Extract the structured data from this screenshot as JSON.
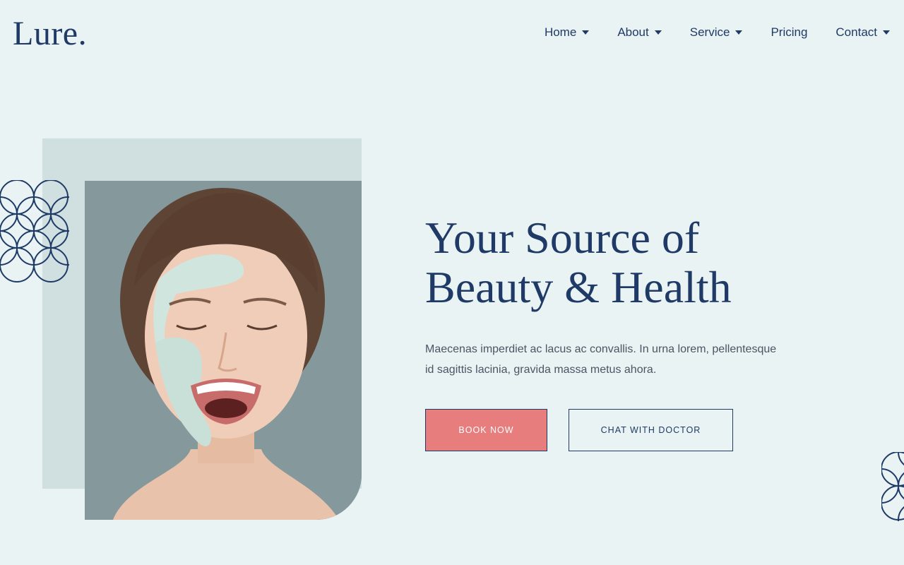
{
  "brand": {
    "logo": "Lure."
  },
  "nav": {
    "items": [
      {
        "label": "Home",
        "has_dropdown": true
      },
      {
        "label": "About",
        "has_dropdown": true
      },
      {
        "label": "Service",
        "has_dropdown": true
      },
      {
        "label": "Pricing",
        "has_dropdown": false
      },
      {
        "label": "Contact",
        "has_dropdown": true
      }
    ]
  },
  "hero": {
    "title_line1": "Your Source of",
    "title_line2": "Beauty & Health",
    "description": "Maecenas imperdiet ac lacus ac convallis. In urna lorem, pellentesque id sagittis lacinia, gravida massa metus ahora.",
    "image_alt": "woman-with-face-mask-smiling",
    "primary_button": "BOOK NOW",
    "secondary_button": "CHAT WITH DOCTOR"
  },
  "colors": {
    "background": "#e9f3f4",
    "navy": "#1f3a66",
    "accent_coral": "#e87d7d",
    "panel": "#d0e0e1",
    "photo_bg": "#85999d"
  }
}
